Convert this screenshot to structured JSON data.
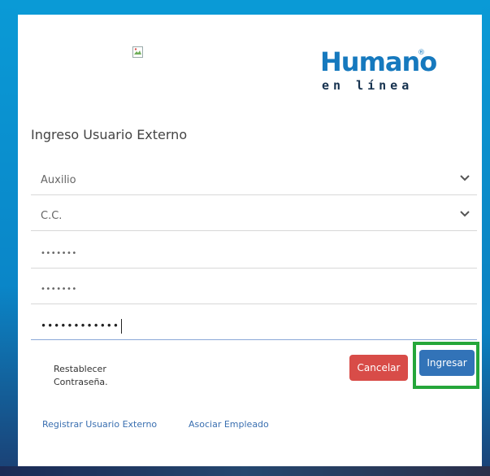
{
  "header": {
    "brand_title": "Humano",
    "brand_reg": "®",
    "brand_subtitle": "en línea"
  },
  "form": {
    "title": "Ingreso Usuario Externo",
    "fields": [
      {
        "type": "select",
        "value": "Auxilio"
      },
      {
        "type": "select",
        "value": "C.C."
      },
      {
        "type": "password",
        "value": "•••••••"
      },
      {
        "type": "password",
        "value": "•••••••"
      },
      {
        "type": "password",
        "value": "••••••••••••"
      }
    ]
  },
  "actions": {
    "reset_line1": "Restablecer",
    "reset_line2": "Contraseña.",
    "cancel_label": "Cancelar",
    "login_label": "Ingresar"
  },
  "footer_links": {
    "register": "Registrar Usuario Externo",
    "associate": "Asociar Empleado"
  },
  "colors": {
    "frame": "#0a9ad6",
    "brand": "#1679be",
    "cancel": "#d84c48",
    "login": "#3273b8",
    "highlight": "#25a63a"
  }
}
